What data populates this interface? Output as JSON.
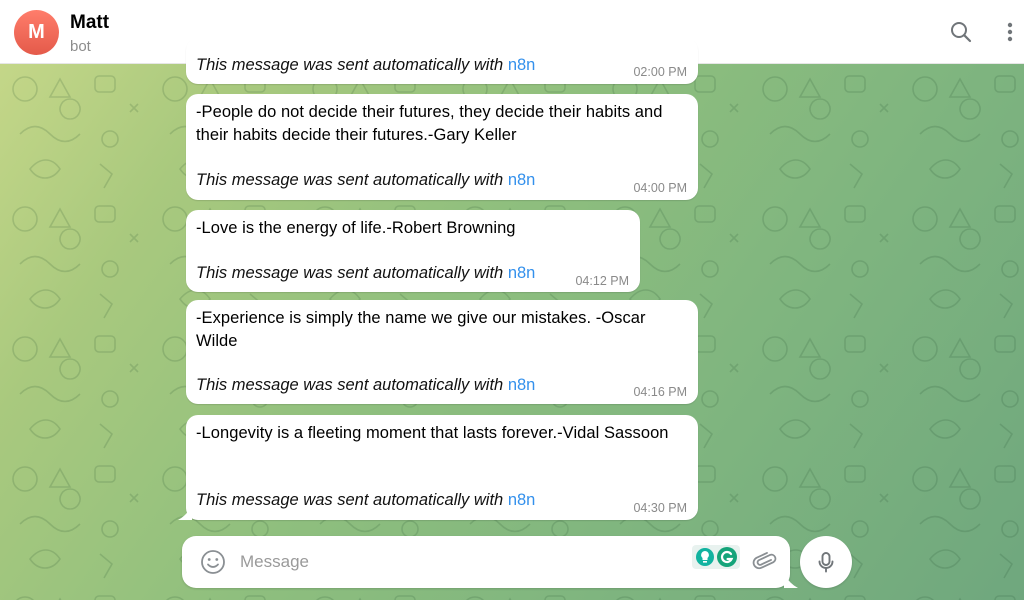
{
  "header": {
    "avatar_letter": "M",
    "name": "Matt",
    "status": "bot",
    "search_icon": "search-icon",
    "menu_icon": "more-vertical-icon"
  },
  "messages": [
    {
      "text": "",
      "auto_note": "This message was sent automatically with",
      "link": "n8n",
      "time": "02:00 PM"
    },
    {
      "text": "-People do not decide their futures, they decide their habits and their habits decide their futures.-Gary Keller",
      "auto_note": "This message was sent automatically with",
      "link": "n8n",
      "time": "04:00 PM"
    },
    {
      "text": "-Love is the energy of life.-Robert Browning",
      "auto_note": "This message was sent automatically with",
      "link": "n8n",
      "time": "04:12 PM"
    },
    {
      "text": "-Experience is simply the name we give our mistakes. -Oscar Wilde",
      "auto_note": "This message was sent automatically with",
      "link": "n8n",
      "time": "04:16 PM"
    },
    {
      "text": "-Longevity is a fleeting moment that lasts forever.-Vidal Sassoon",
      "auto_note": "This message was sent automatically with",
      "link": "n8n",
      "time": "04:30 PM"
    }
  ],
  "composer": {
    "placeholder": "Message",
    "emoji_icon": "smile-icon",
    "attach_icon": "paperclip-icon",
    "mic_icon": "microphone-icon"
  },
  "colors": {
    "accent": "#3390ec",
    "avatar": "#e45a4a",
    "wallpaper_start": "#c9d98a",
    "wallpaper_end": "#6fa77e"
  }
}
